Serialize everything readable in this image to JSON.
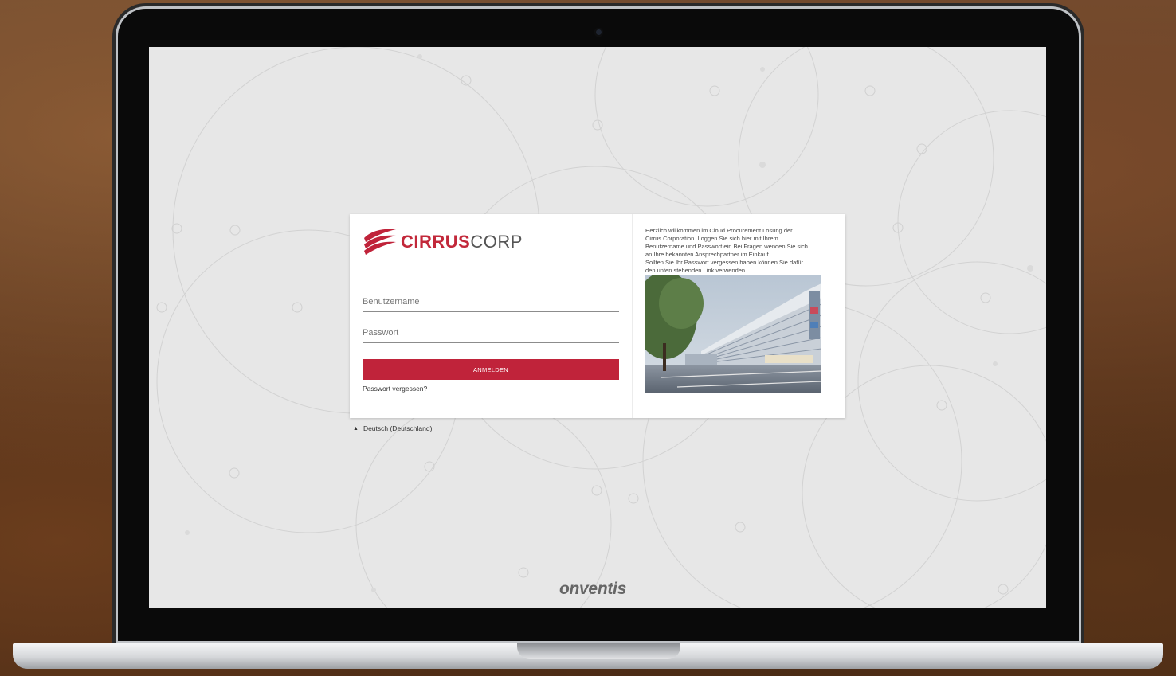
{
  "login": {
    "logo_bold": "CIRRUS",
    "logo_light": "CORP",
    "username_placeholder": "Benutzername",
    "password_placeholder": "Passwort",
    "submit_label": "ANMELDEN",
    "forgot_label": "Passwort vergessen?"
  },
  "welcome": {
    "lines": [
      "Herzlich willkommen im Cloud Procurement Lösung der",
      "Cirrus Corporation. Loggen Sie sich hier mit Ihrem",
      "Benutzername und Passwort ein.Bei Fragen wenden Sie sich",
      "an Ihre bekannten Ansprechpartner im Einkauf.",
      "Sollten Sie Ihr Passwort vergessen haben können Sie dafür",
      "den unten stehenden Link verwenden."
    ]
  },
  "language": {
    "selected": "Deutsch (Deutschland)"
  },
  "footer": {
    "brand": "onventis"
  },
  "colors": {
    "accent": "#c0233a",
    "screen_bg": "#e7e7e7"
  },
  "icons": {
    "language_toggle": "triangle-up-icon"
  }
}
